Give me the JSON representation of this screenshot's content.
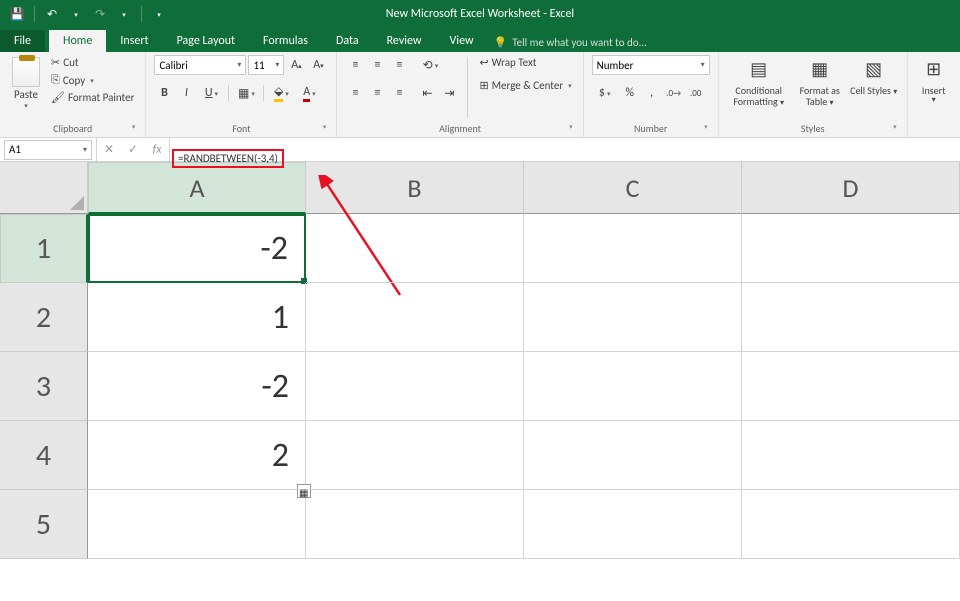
{
  "app": {
    "title": "New Microsoft Excel Worksheet - Excel"
  },
  "tabs": {
    "file": "File",
    "home": "Home",
    "insert": "Insert",
    "pagelayout": "Page Layout",
    "formulas": "Formulas",
    "data": "Data",
    "review": "Review",
    "view": "View",
    "tellme": "Tell me what you want to do..."
  },
  "ribbon": {
    "clipboard": {
      "paste": "Paste",
      "cut": "Cut",
      "copy": "Copy",
      "painter": "Format Painter",
      "label": "Clipboard"
    },
    "font": {
      "name": "Calibri",
      "size": "11",
      "label": "Font"
    },
    "alignment": {
      "wrap": "Wrap Text",
      "merge": "Merge & Center",
      "label": "Alignment"
    },
    "number": {
      "format": "Number",
      "label": "Number"
    },
    "styles": {
      "cf": "Conditional Formatting",
      "fat": "Format as Table",
      "cs": "Cell Styles",
      "label": "Styles"
    },
    "cells": {
      "insert": "Insert"
    }
  },
  "fbar": {
    "name": "A1",
    "formula": "=RANDBETWEEN(-3,4)"
  },
  "columns": [
    "A",
    "B",
    "C",
    "D"
  ],
  "rows": [
    "1",
    "2",
    "3",
    "4",
    "5"
  ],
  "cells": {
    "A1": "-2",
    "A2": "1",
    "A3": "-2",
    "A4": "2"
  }
}
